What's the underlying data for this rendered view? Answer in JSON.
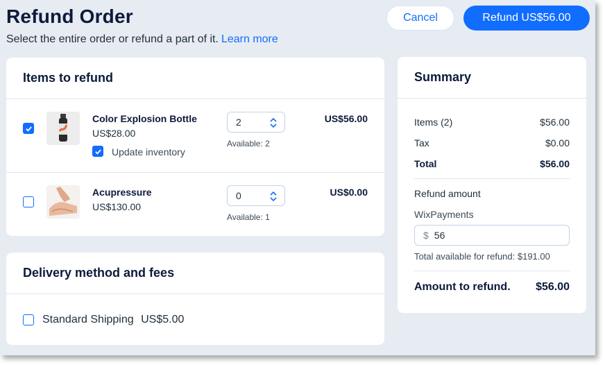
{
  "header": {
    "title": "Refund Order",
    "subtitle": "Select the entire order or refund a part of it.",
    "learn_more": "Learn more",
    "cancel_label": "Cancel",
    "refund_label": "Refund US$56.00"
  },
  "items_card": {
    "title": "Items to refund",
    "items": [
      {
        "name": "Color Explosion Bottle",
        "price": "US$28.00",
        "selected": true,
        "update_inventory_label": "Update inventory",
        "update_inventory": true,
        "quantity": "2",
        "available": "Available: 2",
        "line_total": "US$56.00",
        "image": "bottle-thumbnail"
      },
      {
        "name": "Acupressure",
        "price": "US$130.00",
        "selected": false,
        "quantity": "0",
        "available": "Available: 1",
        "line_total": "US$0.00",
        "image": "hands-thumbnail"
      }
    ]
  },
  "delivery_card": {
    "title": "Delivery method and fees",
    "shipping_label": "Standard Shipping",
    "shipping_price": "US$5.00",
    "selected": false
  },
  "summary": {
    "title": "Summary",
    "items_label": "Items (2)",
    "items_value": "$56.00",
    "tax_label": "Tax",
    "tax_value": "$0.00",
    "total_label": "Total",
    "total_value": "$56.00",
    "refund_amount_label": "Refund amount",
    "payment_method": "WixPayments",
    "currency_symbol": "$",
    "refund_input_value": "56",
    "available_note": "Total available for refund: $191.00",
    "amount_to_refund_label": "Amount to refund.",
    "amount_to_refund_value": "$56.00"
  },
  "colors": {
    "accent": "#116dff",
    "background": "#e7ebf2",
    "card": "#ffffff",
    "heading": "#0c1a3b"
  }
}
